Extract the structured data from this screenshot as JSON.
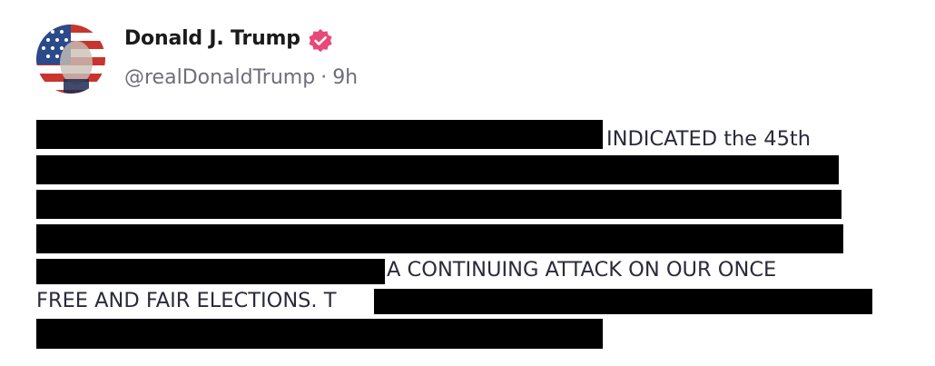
{
  "post": {
    "author": {
      "display_name": "Donald J. Trump",
      "handle": "@realDonaldTrump",
      "verified_icon": "verified-badge-icon",
      "verified_color": "#e8487a"
    },
    "time_separator": "·",
    "time_ago": "9h",
    "body": {
      "segment_1": "INDICATED the 45th",
      "segment_2": "A CONTINUING ATTACK ON OUR ONCE",
      "segment_3": "FREE AND FAIR ELECTIONS. T"
    }
  }
}
